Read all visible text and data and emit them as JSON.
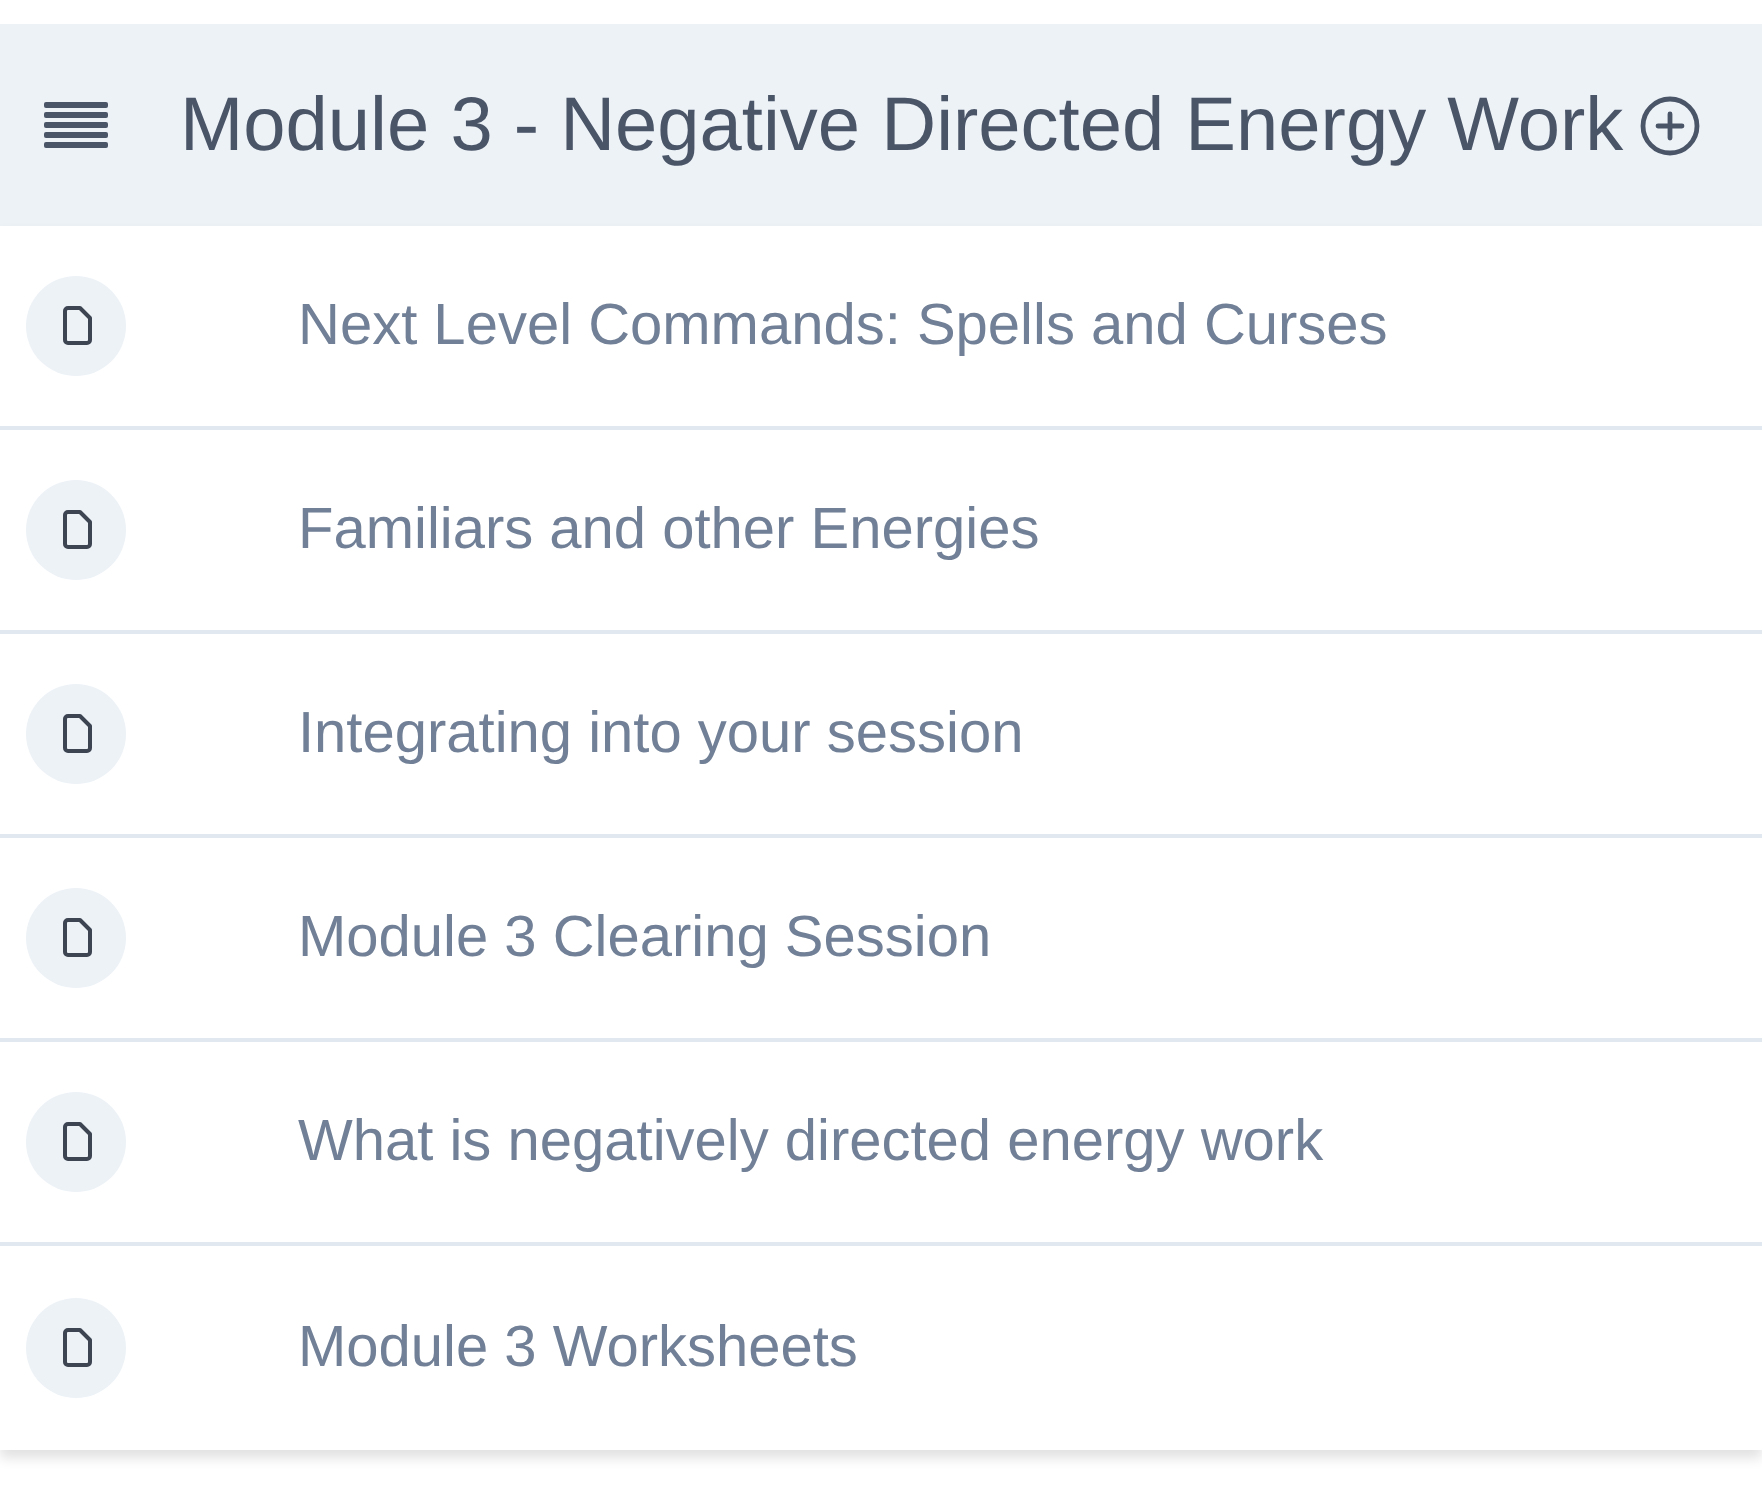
{
  "header": {
    "title": "Module 3 - Negative Directed Energy Work"
  },
  "lessons": [
    {
      "title": "Next Level Commands: Spells and Curses"
    },
    {
      "title": "Familiars and other Energies"
    },
    {
      "title": "Integrating into your session"
    },
    {
      "title": "Module 3 Clearing Session"
    },
    {
      "title": "What is negatively directed energy work"
    },
    {
      "title": "Module 3 Worksheets"
    }
  ]
}
